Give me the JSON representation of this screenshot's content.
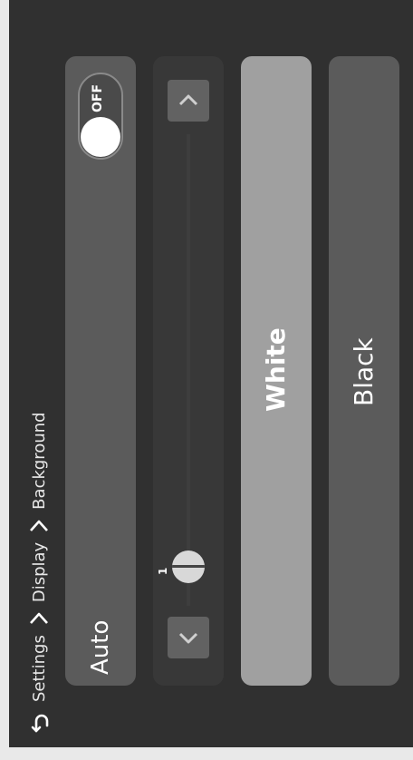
{
  "header": {
    "back_icon": "return-arrow-icon",
    "breadcrumbs": [
      "Settings",
      "Display",
      "Background"
    ],
    "separator_icon": "chevron-right-icon"
  },
  "options": {
    "auto": {
      "label": "Auto",
      "toggle_state": "OFF"
    },
    "white": {
      "label": "White"
    },
    "black": {
      "label": "Black"
    }
  },
  "slider": {
    "value": "1",
    "up_icon": "chevron-up-icon",
    "down_icon": "chevron-down-icon"
  },
  "colors": {
    "background": "#303030",
    "panel": "#5b5b5b",
    "panel_selected": "#a0a0a0",
    "text": "#ffffff"
  }
}
